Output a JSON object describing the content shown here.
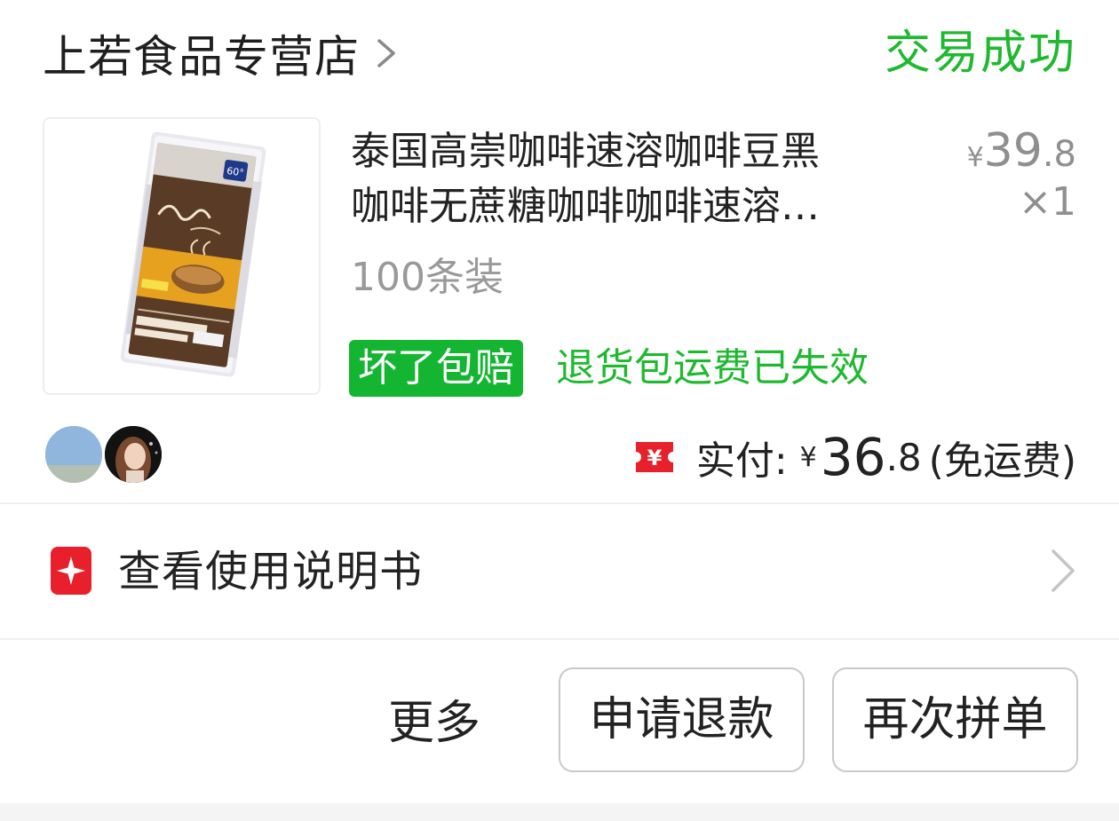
{
  "header": {
    "store_name": "上若食品专营店",
    "status": "交易成功"
  },
  "product": {
    "title_line1": "泰国高崇咖啡速溶咖啡豆黑",
    "title_line2": "咖啡无蔗糖咖啡咖啡速溶…",
    "variant": "100条装",
    "price_currency": "¥",
    "price_int": "39",
    "price_dec": ".8",
    "quantity": "×1",
    "badge": "坏了包赔",
    "badge_note": "退货包运费已失效"
  },
  "payment": {
    "label": "实付:",
    "currency": "¥",
    "amount_int": "36",
    "amount_dec": ".8",
    "note": "(免运费)"
  },
  "manual": {
    "label": "查看使用说明书"
  },
  "actions": {
    "more": "更多",
    "refund": "申请退款",
    "reorder": "再次拼单"
  },
  "colors": {
    "status_green": "#1fb92f",
    "badge_green": "#14b531",
    "red_icon": "#e8202b",
    "muted_gray": "#999999"
  },
  "icons": {
    "store_chevron": "chevron-right-icon",
    "paid": "red-yen-ticket-icon",
    "manual": "red-sparkle-book-icon",
    "manual_chevron": "chevron-right-icon"
  }
}
